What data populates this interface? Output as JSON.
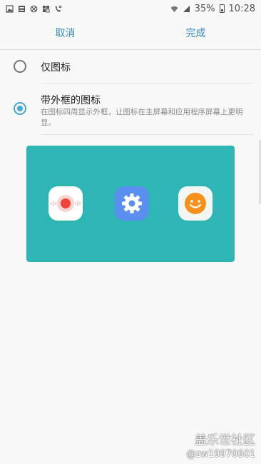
{
  "status": {
    "battery": "35%",
    "time": "10:28",
    "colors": {
      "text": "#555555"
    }
  },
  "actionbar": {
    "cancel": "取消",
    "done": "完成",
    "accent": "#3a8fc0"
  },
  "options": [
    {
      "title": "仅图标",
      "selected": false
    },
    {
      "title": "带外框的图标",
      "description": "在图标四周显示外框，让图标在主屏幕和应用程序屏幕上更明显。",
      "selected": true
    }
  ],
  "preview": {
    "background": "#2fb5b3",
    "icons": [
      "voice-recorder-icon",
      "settings-icon",
      "smiley-icon"
    ]
  },
  "watermark": {
    "line1": "盖乐世社区",
    "line2": "@zw19970601"
  }
}
